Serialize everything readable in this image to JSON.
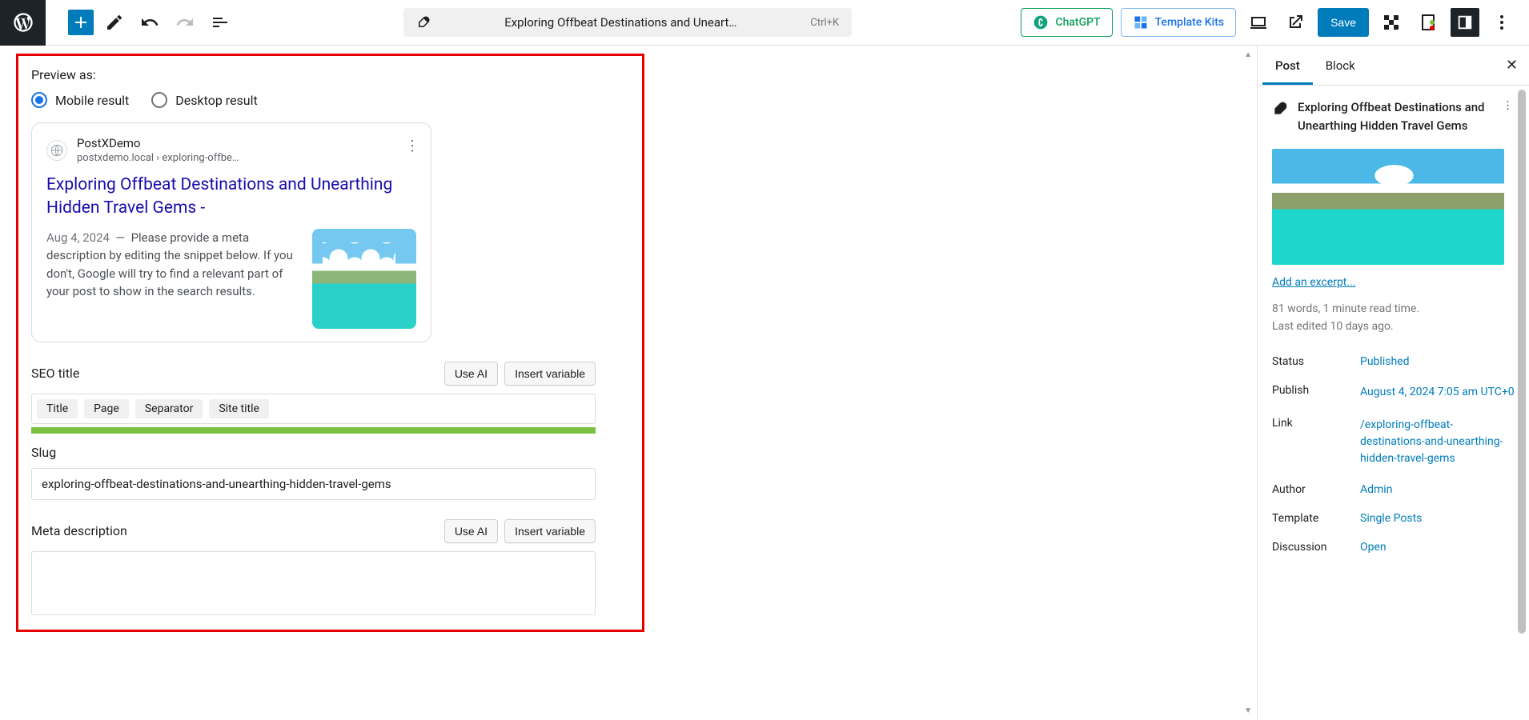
{
  "topbar": {
    "title": "Exploring Offbeat Destinations and Uneart…",
    "shortcut": "Ctrl+K",
    "chatgpt": "ChatGPT",
    "template_kits": "Template Kits",
    "save": "Save"
  },
  "seo_panel": {
    "preview_label": "Preview as:",
    "mobile": "Mobile result",
    "desktop": "Desktop result",
    "serp": {
      "site_name": "PostXDemo",
      "url": "postxdemo.local › exploring-offbe…",
      "title": "Exploring Offbeat Destinations and Unearthing Hidden Travel Gems -",
      "date": "Aug 4, 2024",
      "desc": "Please provide a meta description by editing the snippet below. If you don't, Google will try to find a relevant part of your post to show in the search results."
    },
    "seo_title_label": "SEO title",
    "use_ai": "Use AI",
    "insert_variable": "Insert variable",
    "chips": {
      "title": "Title",
      "page": "Page",
      "separator": "Separator",
      "site_title": "Site title"
    },
    "slug_label": "Slug",
    "slug_value": "exploring-offbeat-destinations-and-unearthing-hidden-travel-gems",
    "meta_label": "Meta description"
  },
  "sidebar": {
    "tab_post": "Post",
    "tab_block": "Block",
    "post_title": "Exploring Offbeat Destinations and Unearthing Hidden Travel Gems",
    "add_excerpt": "Add an excerpt...",
    "word_count": "81 words, 1 minute read time.",
    "last_edited": "Last edited 10 days ago.",
    "rows": {
      "status_k": "Status",
      "status_v": "Published",
      "publish_k": "Publish",
      "publish_v": "August 4, 2024 7:05 am UTC+0",
      "link_k": "Link",
      "link_v": "/exploring-offbeat-destinations-and-unearthing-hidden-travel-gems",
      "author_k": "Author",
      "author_v": "Admin",
      "template_k": "Template",
      "template_v": "Single Posts",
      "discussion_k": "Discussion",
      "discussion_v": "Open"
    }
  }
}
